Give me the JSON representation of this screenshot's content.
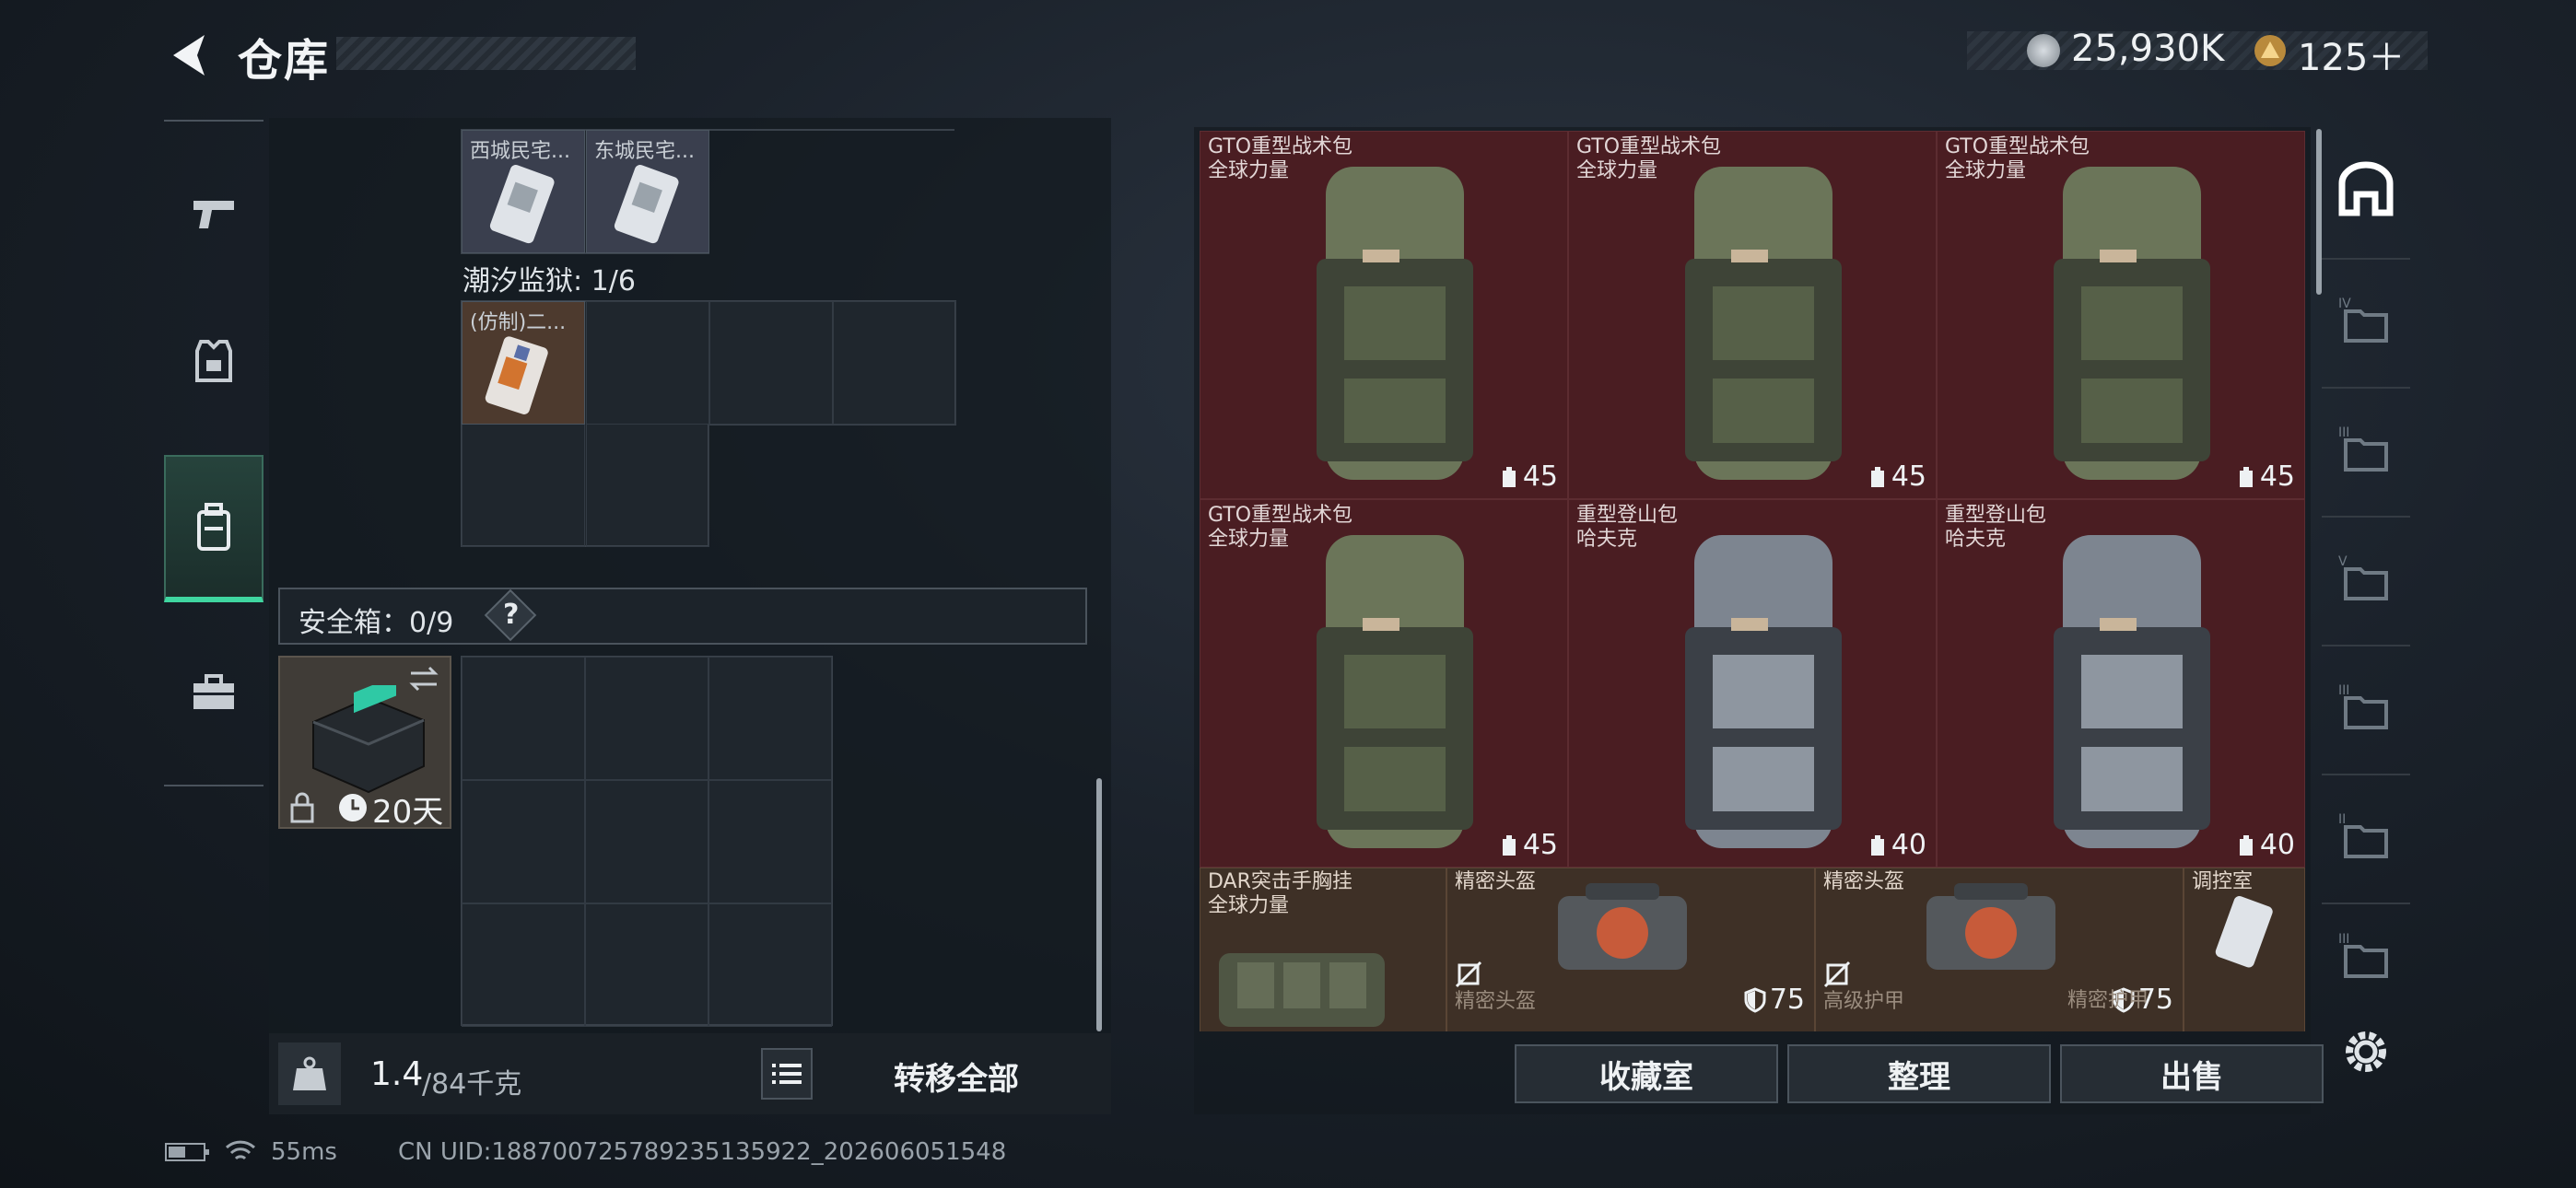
{
  "header": {
    "title": "仓库",
    "currency_a": "25,930K",
    "currency_b": "125＋"
  },
  "left_nav": [
    {
      "icon": "pistol-icon"
    },
    {
      "icon": "armor-vest-icon"
    },
    {
      "icon": "backpack-icon",
      "active": true
    },
    {
      "icon": "toolbox-icon"
    }
  ],
  "keys": {
    "top_items": [
      "西城民宅...",
      "东城民宅..."
    ],
    "prison_label": "潮汐监狱: 1/6",
    "prison_items": [
      "(仿制)二..."
    ]
  },
  "safebox": {
    "label": "安全箱：0/9",
    "help": "?",
    "timer": "20天"
  },
  "weight": {
    "current": "1.4",
    "max": "/84千克",
    "transfer_all": "转移全部"
  },
  "tiles": [
    {
      "name": "GTO重型战术包",
      "brand": "全球力量",
      "count": "45"
    },
    {
      "name": "GTO重型战术包",
      "brand": "全球力量",
      "count": "45"
    },
    {
      "name": "GTO重型战术包",
      "brand": "全球力量",
      "count": "45"
    },
    {
      "name": "GTO重型战术包",
      "brand": "全球力量",
      "count": "45"
    },
    {
      "name": "重型登山包",
      "brand": "哈夫克",
      "count": "40"
    },
    {
      "name": "重型登山包",
      "brand": "哈夫克",
      "count": "40"
    }
  ],
  "bottom_tiles": {
    "chest_rig": {
      "name": "DAR突击手胸挂",
      "brand": "全球力量"
    },
    "helmet1": {
      "name": "精密头盔",
      "value": "75"
    },
    "helmet2": {
      "name": "精密头盔",
      "value": "75"
    },
    "control": {
      "name": "调控室"
    },
    "row2": [
      "精密头盔",
      "高级护甲",
      "精密护甲"
    ]
  },
  "buttons": {
    "collection": "收藏室",
    "sort": "整理",
    "sell": "出售"
  },
  "status": {
    "ping": "55ms",
    "uid": "CN UID:18870072578923513592​2_202606051548"
  },
  "colors": {
    "accent": "#3fd6a0",
    "tile_red": "#4a1d22",
    "tile_brown": "#3e3026"
  }
}
